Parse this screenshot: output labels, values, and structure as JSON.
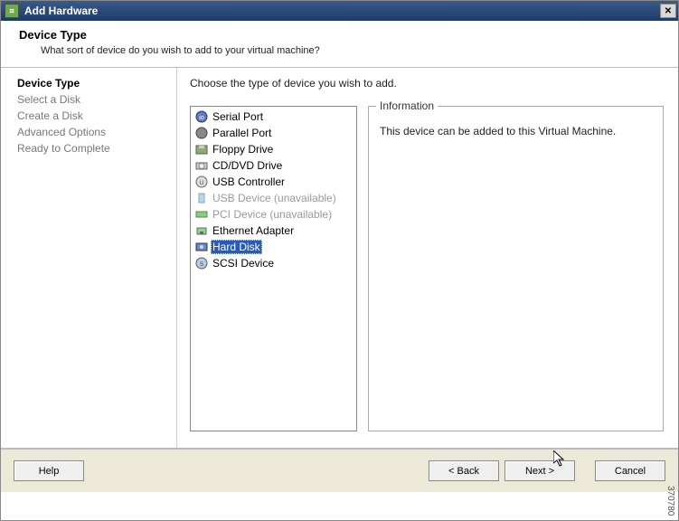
{
  "titlebar": {
    "title": "Add Hardware"
  },
  "header": {
    "title": "Device Type",
    "subtitle": "What sort of device do you wish to add to your virtual machine?"
  },
  "sidebar": {
    "steps": [
      {
        "label": "Device Type",
        "current": true
      },
      {
        "label": "Select a Disk",
        "current": false
      },
      {
        "label": "Create a Disk",
        "current": false
      },
      {
        "label": "Advanced Options",
        "current": false
      },
      {
        "label": "Ready to Complete",
        "current": false
      }
    ]
  },
  "content": {
    "instruction": "Choose the type of device you wish to add.",
    "devices": [
      {
        "label": "Serial Port",
        "icon": "serial-port-icon",
        "disabled": false,
        "selected": false
      },
      {
        "label": "Parallel Port",
        "icon": "parallel-port-icon",
        "disabled": false,
        "selected": false
      },
      {
        "label": "Floppy Drive",
        "icon": "floppy-drive-icon",
        "disabled": false,
        "selected": false
      },
      {
        "label": "CD/DVD Drive",
        "icon": "cd-dvd-drive-icon",
        "disabled": false,
        "selected": false
      },
      {
        "label": "USB Controller",
        "icon": "usb-controller-icon",
        "disabled": false,
        "selected": false
      },
      {
        "label": "USB Device (unavailable)",
        "icon": "usb-device-icon",
        "disabled": true,
        "selected": false
      },
      {
        "label": "PCI Device (unavailable)",
        "icon": "pci-device-icon",
        "disabled": true,
        "selected": false
      },
      {
        "label": "Ethernet Adapter",
        "icon": "ethernet-adapter-icon",
        "disabled": false,
        "selected": false
      },
      {
        "label": "Hard Disk",
        "icon": "hard-disk-icon",
        "disabled": false,
        "selected": true
      },
      {
        "label": "SCSI Device",
        "icon": "scsi-device-icon",
        "disabled": false,
        "selected": false
      }
    ],
    "info_title": "Information",
    "info_text": "This device can be added to this Virtual Machine."
  },
  "buttons": {
    "help": "Help",
    "back": "< Back",
    "next": "Next >",
    "cancel": "Cancel"
  },
  "image_id": "370780"
}
